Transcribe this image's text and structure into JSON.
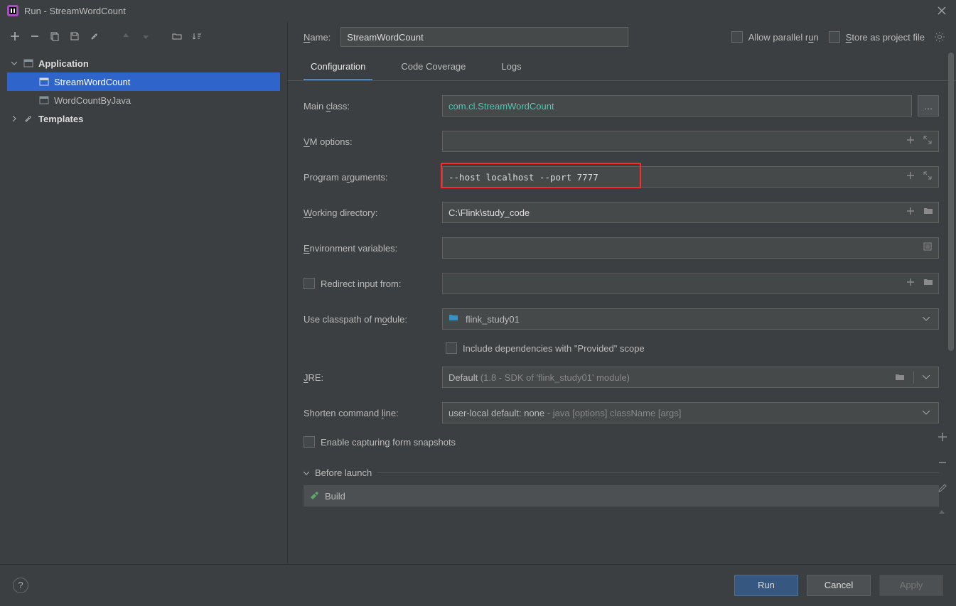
{
  "titlebar": {
    "title": "Run - StreamWordCount"
  },
  "sidebar": {
    "application_label": "Application",
    "items": [
      "StreamWordCount",
      "WordCountByJava"
    ],
    "templates_label": "Templates"
  },
  "toprow": {
    "name_label": "Name:",
    "name_value": "StreamWordCount",
    "allow_parallel": "Allow parallel run",
    "store_as_project": "Store as project file"
  },
  "tabs": {
    "configuration": "Configuration",
    "code_coverage": "Code Coverage",
    "logs": "Logs"
  },
  "form": {
    "main_class_label": "Main class:",
    "main_class_value": "com.cl.StreamWordCount",
    "vm_options_label": "VM options:",
    "vm_options_value": "",
    "program_args_label": "Program arguments:",
    "program_args_value": "--host localhost --port 7777",
    "working_dir_label": "Working directory:",
    "working_dir_value": "C:\\Flink\\study_code",
    "env_vars_label": "Environment variables:",
    "env_vars_value": "",
    "redirect_input_label": "Redirect input from:",
    "classpath_label": "Use classpath of module:",
    "classpath_value": "flink_study01",
    "include_provided_label": "Include dependencies with \"Provided\" scope",
    "jre_label": "JRE:",
    "jre_value": "Default",
    "jre_hint": "(1.8 - SDK of 'flink_study01' module)",
    "shorten_label": "Shorten command line:",
    "shorten_value": "user-local default: none",
    "shorten_hint": " - java [options] className [args]",
    "enable_snapshots_label": "Enable capturing form snapshots",
    "before_launch_label": "Before launch",
    "build_label": "Build"
  },
  "buttons": {
    "run": "Run",
    "cancel": "Cancel",
    "apply": "Apply",
    "help": "?"
  }
}
